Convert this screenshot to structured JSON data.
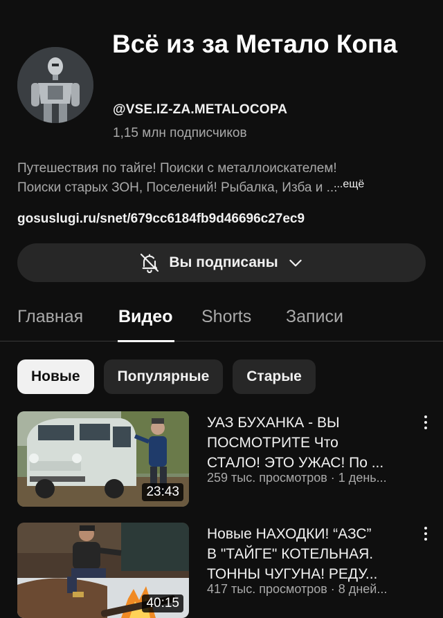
{
  "channel": {
    "title": "Всё из за Метало Копа",
    "handle": "@VSE.IZ-ZA.METALOCOPA",
    "subscribers": "1,15 млн подписчиков",
    "description_line1": "Путешествия по тайге! Поиски с металлоискателем!",
    "description_line2": "Поиски старых ЗОН, Поселений! Рыбалка, Изба и ...",
    "more_label": "...ещё",
    "link": "gosuslugi.ru/snet/679cc6184fb9d46696c27ec9",
    "subscribe_label": "Вы подписаны"
  },
  "tabs": [
    {
      "label": "Главная",
      "active": false
    },
    {
      "label": "Видео",
      "active": true
    },
    {
      "label": "Shorts",
      "active": false
    },
    {
      "label": "Записи",
      "active": false
    }
  ],
  "chips": [
    {
      "label": "Новые",
      "active": true
    },
    {
      "label": "Популярные",
      "active": false
    },
    {
      "label": "Старые",
      "active": false
    }
  ],
  "videos": [
    {
      "title_line1": "УАЗ БУХАНКА - ВЫ",
      "title_line2": "ПОСМОТРИТЕ Что",
      "title_line3": "СТАЛО! ЭТО УЖАС! По ...",
      "meta": "259 тыс. просмотров · 1 день...",
      "duration": "23:43"
    },
    {
      "title_line1": "Новые НАХОДКИ! “АЗС”",
      "title_line2": "В \"ТАЙГЕ\" КОТЕЛЬНАЯ.",
      "title_line3": "ТОННЫ ЧУГУНА! РЕДУ...",
      "meta": "417 тыс. просмотров · 8 дней...",
      "duration": "40:15"
    }
  ],
  "icons": {
    "bell": "bell-off-icon",
    "chevron": "chevron-down-icon",
    "menu": "more-vert-icon"
  }
}
